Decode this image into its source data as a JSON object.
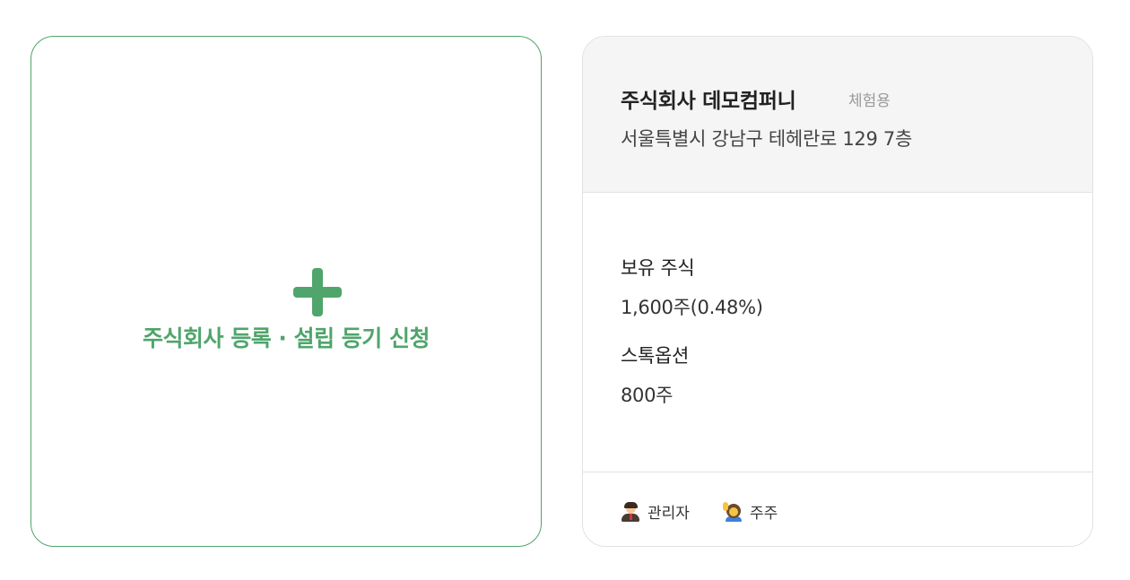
{
  "add_card": {
    "icon": "plus-icon",
    "label": "주식회사 등록 · 설립 등기 신청",
    "accent": "#4fa56b"
  },
  "company": {
    "name": "주식회사 데모컴퍼니",
    "badge": "체험용",
    "address": "서울특별시 강남구 테헤란로 129 7층",
    "shares_label": "보유 주식",
    "shares_value": "1,600주(0.48%)",
    "options_label": "스톡옵션",
    "options_value": "800주",
    "roles": [
      {
        "label": "관리자",
        "icon": "admin-person-icon"
      },
      {
        "label": "주주",
        "icon": "raising-hand-person-icon"
      }
    ]
  }
}
